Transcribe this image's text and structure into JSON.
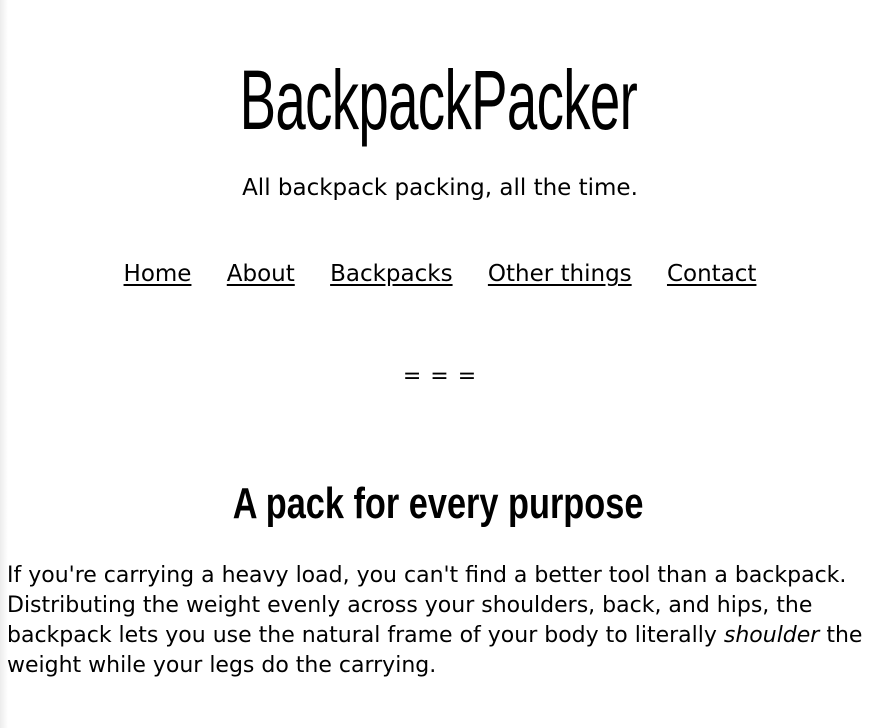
{
  "site": {
    "title": "BackpackPacker",
    "tagline": "All backpack packing, all the time."
  },
  "nav": {
    "items": [
      {
        "label": "Home"
      },
      {
        "label": "About"
      },
      {
        "label": "Backpacks"
      },
      {
        "label": "Other things"
      },
      {
        "label": "Contact"
      }
    ]
  },
  "divider": {
    "text": "= = ="
  },
  "article": {
    "heading": "A pack for every purpose",
    "paragraph": {
      "before_emphasis": "If you're carrying a heavy load, you can't find a better tool than a backpack. Distributing the weight evenly across your shoulders, back, and hips, the backpack lets you use the natural frame of your body to literally ",
      "emphasis": "shoulder",
      "after_emphasis": " the weight while your legs do the carrying."
    }
  },
  "colors": {
    "background": "#ffffff",
    "text": "#000000"
  }
}
